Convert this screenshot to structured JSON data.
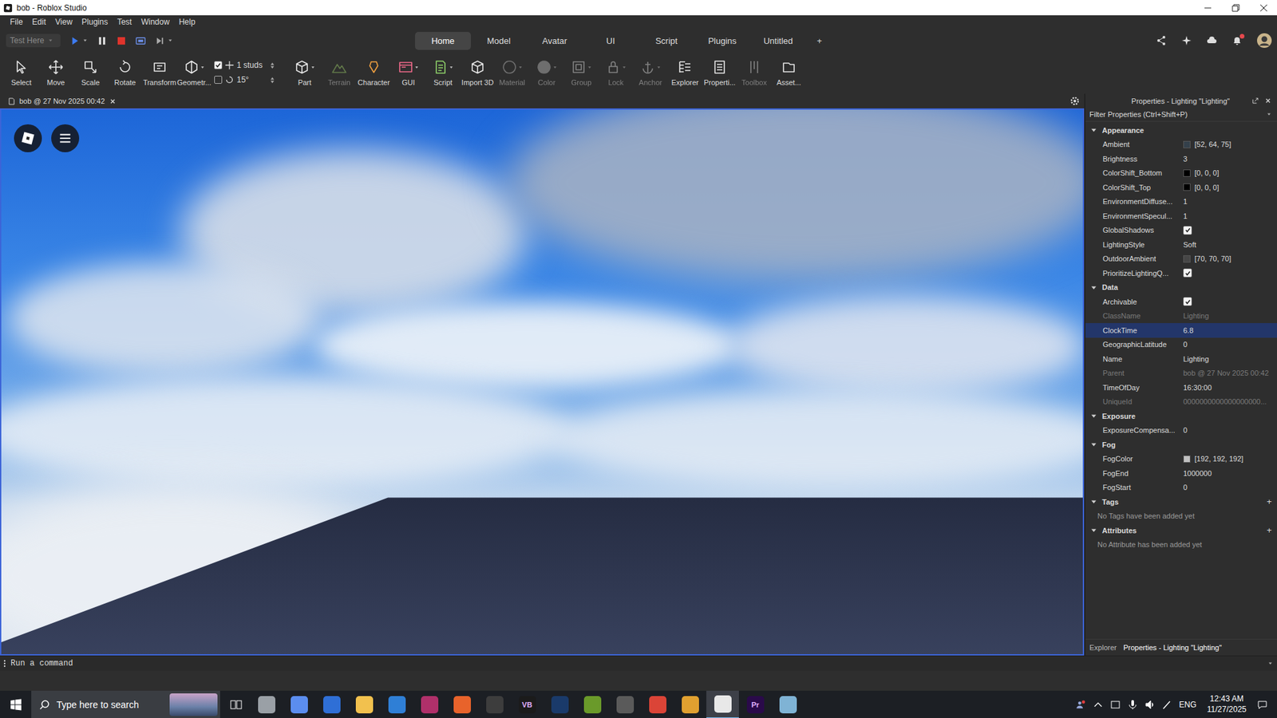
{
  "window": {
    "title": "bob - Roblox Studio"
  },
  "menu": [
    "File",
    "Edit",
    "View",
    "Plugins",
    "Test",
    "Window",
    "Help"
  ],
  "test_controls": {
    "mode": "Test Here"
  },
  "tabs": [
    {
      "label": "Home",
      "selected": true
    },
    {
      "label": "Model",
      "selected": false
    },
    {
      "label": "Avatar",
      "selected": false
    },
    {
      "label": "UI",
      "selected": false
    },
    {
      "label": "Script",
      "selected": false
    },
    {
      "label": "Plugins",
      "selected": false
    },
    {
      "label": "Untitled",
      "selected": false
    }
  ],
  "add_tab": "+",
  "ribbon": {
    "tools": [
      {
        "label": "Select",
        "dropdown": false,
        "disabled": false
      },
      {
        "label": "Move",
        "dropdown": false,
        "disabled": false
      },
      {
        "label": "Scale",
        "dropdown": false,
        "disabled": false
      },
      {
        "label": "Rotate",
        "dropdown": false,
        "disabled": false
      },
      {
        "label": "Transform",
        "dropdown": false,
        "disabled": false
      },
      {
        "label": "Geometr...",
        "dropdown": true,
        "disabled": false
      }
    ],
    "snap": [
      {
        "checked": true,
        "value": "1 studs"
      },
      {
        "checked": false,
        "value": "15°"
      }
    ],
    "tools_2": [
      {
        "label": "Part",
        "dropdown": true,
        "disabled": false
      },
      {
        "label": "Terrain",
        "dropdown": false,
        "disabled": true
      },
      {
        "label": "Character",
        "dropdown": false,
        "disabled": false
      },
      {
        "label": "GUI",
        "dropdown": true,
        "disabled": false
      },
      {
        "label": "Script",
        "dropdown": true,
        "disabled": false
      },
      {
        "label": "Import 3D",
        "dropdown": false,
        "disabled": false
      },
      {
        "label": "Material",
        "dropdown": true,
        "disabled": true
      },
      {
        "label": "Color",
        "dropdown": true,
        "disabled": true
      },
      {
        "label": "Group",
        "dropdown": true,
        "disabled": true
      },
      {
        "label": "Lock",
        "dropdown": true,
        "disabled": true
      },
      {
        "label": "Anchor",
        "dropdown": true,
        "disabled": true
      },
      {
        "label": "Explorer",
        "dropdown": false,
        "disabled": false
      },
      {
        "label": "Properti...",
        "dropdown": false,
        "disabled": false
      },
      {
        "label": "Toolbox",
        "dropdown": false,
        "disabled": true
      },
      {
        "label": "Asset...",
        "dropdown": false,
        "disabled": false
      }
    ]
  },
  "document_tab": {
    "label": "bob @ 27 Nov 2025 00:42"
  },
  "properties": {
    "title": "Properties - Lighting \"Lighting\"",
    "filter_placeholder": "Filter Properties (Ctrl+Shift+P)",
    "sections": [
      {
        "name": "Appearance",
        "expanded": true,
        "rows": [
          {
            "name": "Ambient",
            "kind": "color",
            "value": "[52, 64, 75]",
            "color": "#34404b",
            "disabled": false,
            "selected": false
          },
          {
            "name": "Brightness",
            "kind": "text",
            "value": "3",
            "disabled": false,
            "selected": false
          },
          {
            "name": "ColorShift_Bottom",
            "kind": "color",
            "value": "[0, 0, 0]",
            "color": "#000000",
            "disabled": false,
            "selected": false
          },
          {
            "name": "ColorShift_Top",
            "kind": "color",
            "value": "[0, 0, 0]",
            "color": "#000000",
            "disabled": false,
            "selected": false
          },
          {
            "name": "EnvironmentDiffuse...",
            "kind": "text",
            "value": "1",
            "disabled": false,
            "selected": false
          },
          {
            "name": "EnvironmentSpecul...",
            "kind": "text",
            "value": "1",
            "disabled": false,
            "selected": false
          },
          {
            "name": "GlobalShadows",
            "kind": "checkbox",
            "checked": true,
            "disabled": false,
            "selected": false
          },
          {
            "name": "LightingStyle",
            "kind": "text",
            "value": "Soft",
            "disabled": false,
            "selected": false
          },
          {
            "name": "OutdoorAmbient",
            "kind": "color",
            "value": "[70, 70, 70]",
            "color": "#464646",
            "disabled": false,
            "selected": false
          },
          {
            "name": "PrioritizeLightingQ...",
            "kind": "checkbox",
            "checked": true,
            "disabled": false,
            "selected": false
          }
        ]
      },
      {
        "name": "Data",
        "expanded": true,
        "rows": [
          {
            "name": "Archivable",
            "kind": "checkbox",
            "checked": true,
            "disabled": false,
            "selected": false
          },
          {
            "name": "ClassName",
            "kind": "text",
            "value": "Lighting",
            "disabled": true,
            "selected": false
          },
          {
            "name": "ClockTime",
            "kind": "text",
            "value": "6.8",
            "disabled": false,
            "selected": true
          },
          {
            "name": "GeographicLatitude",
            "kind": "text",
            "value": "0",
            "disabled": false,
            "selected": false
          },
          {
            "name": "Name",
            "kind": "text",
            "value": "Lighting",
            "disabled": false,
            "selected": false
          },
          {
            "name": "Parent",
            "kind": "text",
            "value": "bob @ 27 Nov 2025 00:42",
            "disabled": true,
            "selected": false
          },
          {
            "name": "TimeOfDay",
            "kind": "text",
            "value": "16:30:00",
            "disabled": false,
            "selected": false
          },
          {
            "name": "UniqueId",
            "kind": "text",
            "value": "0000000000000000000...",
            "disabled": true,
            "selected": false
          }
        ]
      },
      {
        "name": "Exposure",
        "expanded": true,
        "rows": [
          {
            "name": "ExposureCompensa...",
            "kind": "text",
            "value": "0",
            "disabled": false,
            "selected": false
          }
        ]
      },
      {
        "name": "Fog",
        "expanded": true,
        "rows": [
          {
            "name": "FogColor",
            "kind": "color",
            "value": "[192, 192, 192]",
            "color": "#c0c0c0",
            "disabled": false,
            "selected": false
          },
          {
            "name": "FogEnd",
            "kind": "text",
            "value": "1000000",
            "disabled": false,
            "selected": false
          },
          {
            "name": "FogStart",
            "kind": "text",
            "value": "0",
            "disabled": false,
            "selected": false
          }
        ]
      },
      {
        "name": "Tags",
        "expanded": true,
        "add": "+",
        "empty": "No Tags have been added yet",
        "rows": []
      },
      {
        "name": "Attributes",
        "expanded": true,
        "add": "+",
        "empty": "No Attribute has been added yet",
        "rows": []
      }
    ]
  },
  "command_bar": {
    "placeholder": "Run a command"
  },
  "panel_tabs": [
    {
      "label": "Explorer",
      "selected": false
    },
    {
      "label": "Properties - Lighting \"Lighting\"",
      "selected": true
    }
  ],
  "taskbar": {
    "search_placeholder": "Type here to search",
    "apps": [
      {
        "color": "#9aa0a6",
        "selected": false
      },
      {
        "color": "#5b8def",
        "selected": false
      },
      {
        "color": "#2f6fd6",
        "selected": false
      },
      {
        "color": "#f2c14e",
        "selected": false
      },
      {
        "color": "#2f7fd6",
        "selected": false
      },
      {
        "color": "#b0306a",
        "selected": false
      },
      {
        "color": "#e8632b",
        "selected": false
      },
      {
        "color": "#3d3d3d",
        "selected": false
      },
      {
        "color": "#1b1b1b",
        "glyph": "VB",
        "selected": false
      },
      {
        "color": "#1a3a6a",
        "selected": false
      },
      {
        "color": "#6a9a2a",
        "selected": false
      },
      {
        "color": "#5a5a5a",
        "selected": false
      },
      {
        "color": "#db4437",
        "selected": false
      },
      {
        "color": "#e0a030",
        "selected": false
      },
      {
        "color": "#e8e8e8",
        "selected": true
      },
      {
        "color": "#2a0a4a",
        "glyph": "Pr",
        "selected": false
      },
      {
        "color": "#7fb3d5",
        "selected": false
      }
    ],
    "language": "ENG",
    "time": "12:43 AM",
    "date": "11/27/2025"
  }
}
